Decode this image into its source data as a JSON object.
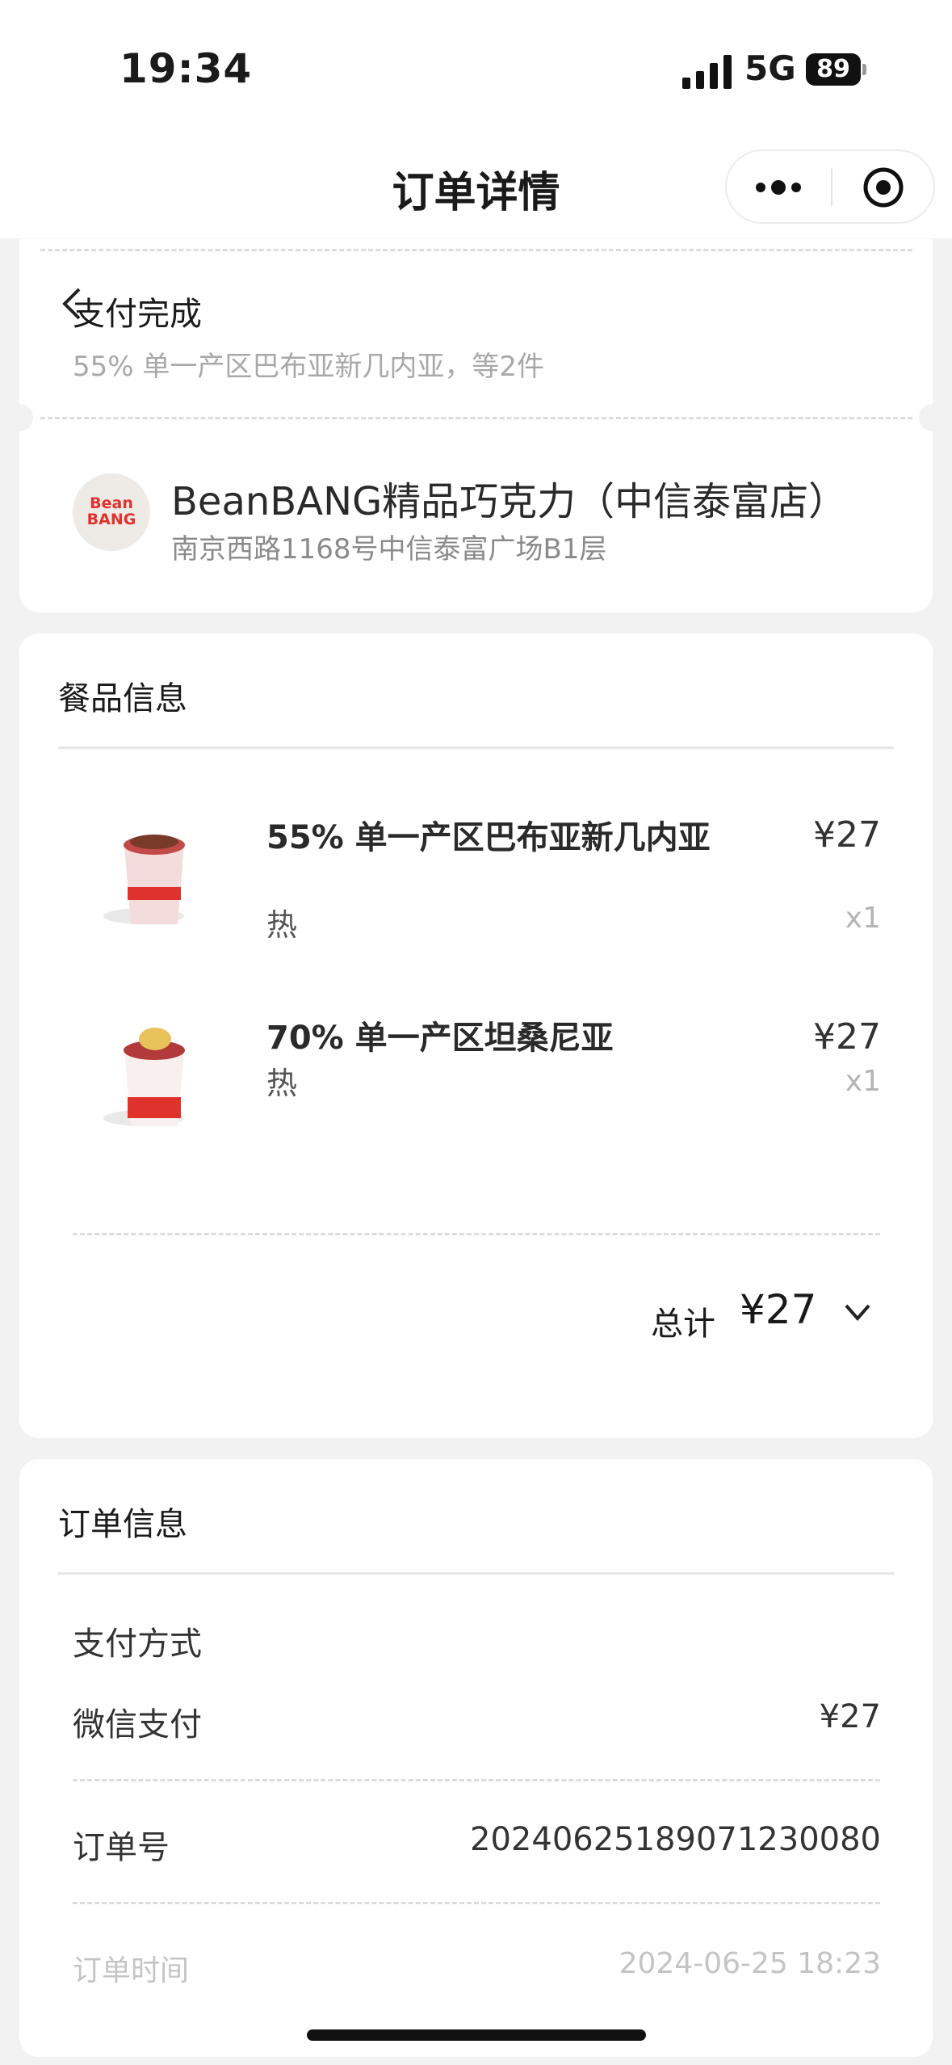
{
  "status_bar": {
    "time": "19:34",
    "network": "5G",
    "battery": "89"
  },
  "nav": {
    "title": "订单详情"
  },
  "order_status": {
    "status": "支付完成",
    "summary": "55% 单一产区巴布亚新几内亚，等2件"
  },
  "store": {
    "logo_line1": "Bean",
    "logo_line2": "BANG",
    "name": "BeanBANG精品巧克力（中信泰富店）",
    "address": "南京西路1168号中信泰富广场B1层"
  },
  "items_section": {
    "title": "餐品信息",
    "items": [
      {
        "name": "55% 单一产区巴布亚新几内亚",
        "option": "热",
        "price": "¥27",
        "qty": "x1"
      },
      {
        "name": "70% 单一产区坦桑尼亚",
        "option": "热",
        "price": "¥27",
        "qty": "x1"
      }
    ],
    "total_label": "总计",
    "total_value": "¥27"
  },
  "order_section": {
    "title": "订单信息",
    "payment_method_label": "支付方式",
    "payment_method": "微信支付",
    "payment_amount": "¥27",
    "order_no_label": "订单号",
    "order_no": "20240625189071230080",
    "order_time_label": "订单时间",
    "order_time": "2024-06-25 18:23"
  },
  "colors": {
    "brand_red": "#e0322d",
    "background": "#f2f2f2"
  }
}
